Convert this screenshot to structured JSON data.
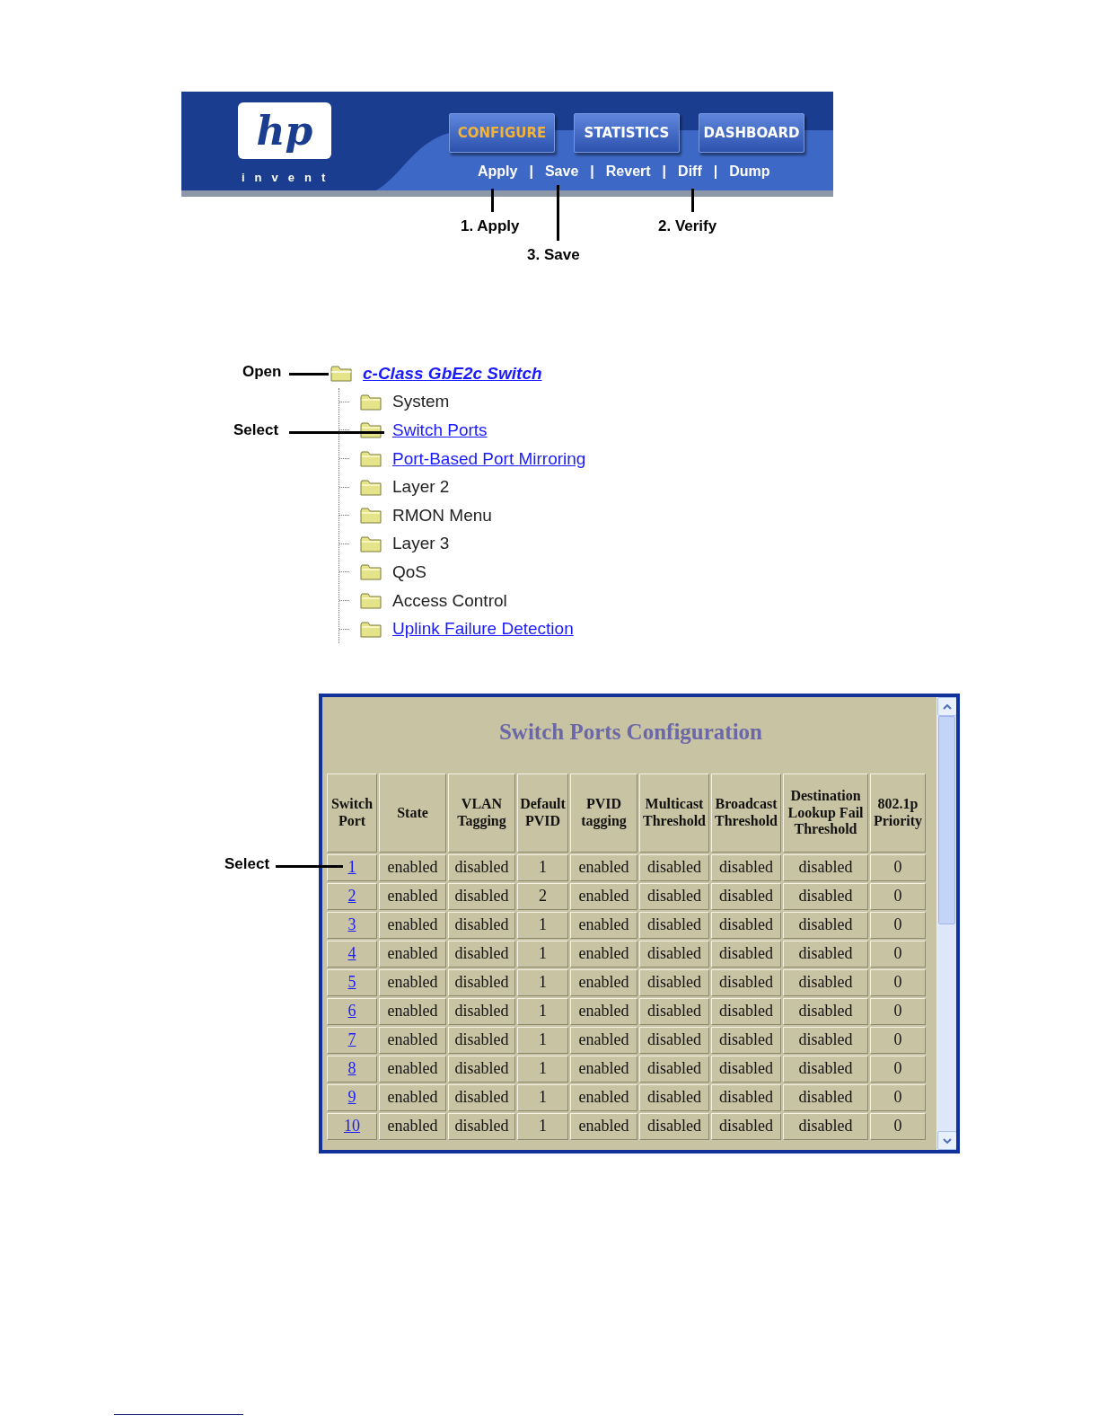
{
  "banner": {
    "logo_mark": "hp",
    "logo_tagline": "invent",
    "tabs": [
      {
        "label": "CONFIGURE",
        "selected": true
      },
      {
        "label": "STATISTICS",
        "selected": false
      },
      {
        "label": "DASHBOARD",
        "selected": false
      }
    ],
    "actions": [
      {
        "label": "Apply"
      },
      {
        "label": "Save"
      },
      {
        "label": "Revert"
      },
      {
        "label": "Diff"
      },
      {
        "label": "Dump"
      }
    ],
    "separators": [
      "|",
      "|",
      "|",
      "|"
    ]
  },
  "banner_callouts": [
    {
      "label": "1. Apply"
    },
    {
      "label": "3. Save"
    },
    {
      "label": "2. Verify"
    }
  ],
  "tree": {
    "label": "c-Class GbE2c Switch",
    "link": true,
    "children": [
      {
        "label": "System",
        "link": false
      },
      {
        "label": "Switch Ports",
        "link": true
      },
      {
        "label": "Port-Based Port Mirroring",
        "link": true
      },
      {
        "label": "Layer 2",
        "link": false
      },
      {
        "label": "RMON Menu",
        "link": false
      },
      {
        "label": "Layer 3",
        "link": false
      },
      {
        "label": "QoS",
        "link": false
      },
      {
        "label": "Access Control",
        "link": false
      },
      {
        "label": "Uplink Failure Detection",
        "link": true
      }
    ]
  },
  "tree_callouts": [
    {
      "label": "Open"
    },
    {
      "label": "Select"
    }
  ],
  "table_window": {
    "title": "Switch Ports Configuration",
    "columns": [
      "Switch Port",
      "State",
      "VLAN Tagging",
      "Default PVID",
      "PVID tagging",
      "Multicast Threshold",
      "Broadcast Threshold",
      "Destination Lookup Fail Threshold",
      "802.1p Priority"
    ],
    "rows": [
      [
        "1",
        "enabled",
        "disabled",
        "1",
        "enabled",
        "disabled",
        "disabled",
        "disabled",
        "0"
      ],
      [
        "2",
        "enabled",
        "disabled",
        "2",
        "enabled",
        "disabled",
        "disabled",
        "disabled",
        "0"
      ],
      [
        "3",
        "enabled",
        "disabled",
        "1",
        "enabled",
        "disabled",
        "disabled",
        "disabled",
        "0"
      ],
      [
        "4",
        "enabled",
        "disabled",
        "1",
        "enabled",
        "disabled",
        "disabled",
        "disabled",
        "0"
      ],
      [
        "5",
        "enabled",
        "disabled",
        "1",
        "enabled",
        "disabled",
        "disabled",
        "disabled",
        "0"
      ],
      [
        "6",
        "enabled",
        "disabled",
        "1",
        "enabled",
        "disabled",
        "disabled",
        "disabled",
        "0"
      ],
      [
        "7",
        "enabled",
        "disabled",
        "1",
        "enabled",
        "disabled",
        "disabled",
        "disabled",
        "0"
      ],
      [
        "8",
        "enabled",
        "disabled",
        "1",
        "enabled",
        "disabled",
        "disabled",
        "disabled",
        "0"
      ],
      [
        "9",
        "enabled",
        "disabled",
        "1",
        "enabled",
        "disabled",
        "disabled",
        "disabled",
        "0"
      ],
      [
        "10",
        "enabled",
        "disabled",
        "1",
        "enabled",
        "disabled",
        "disabled",
        "disabled",
        "0"
      ]
    ]
  },
  "table_callout": {
    "label": "Select"
  }
}
